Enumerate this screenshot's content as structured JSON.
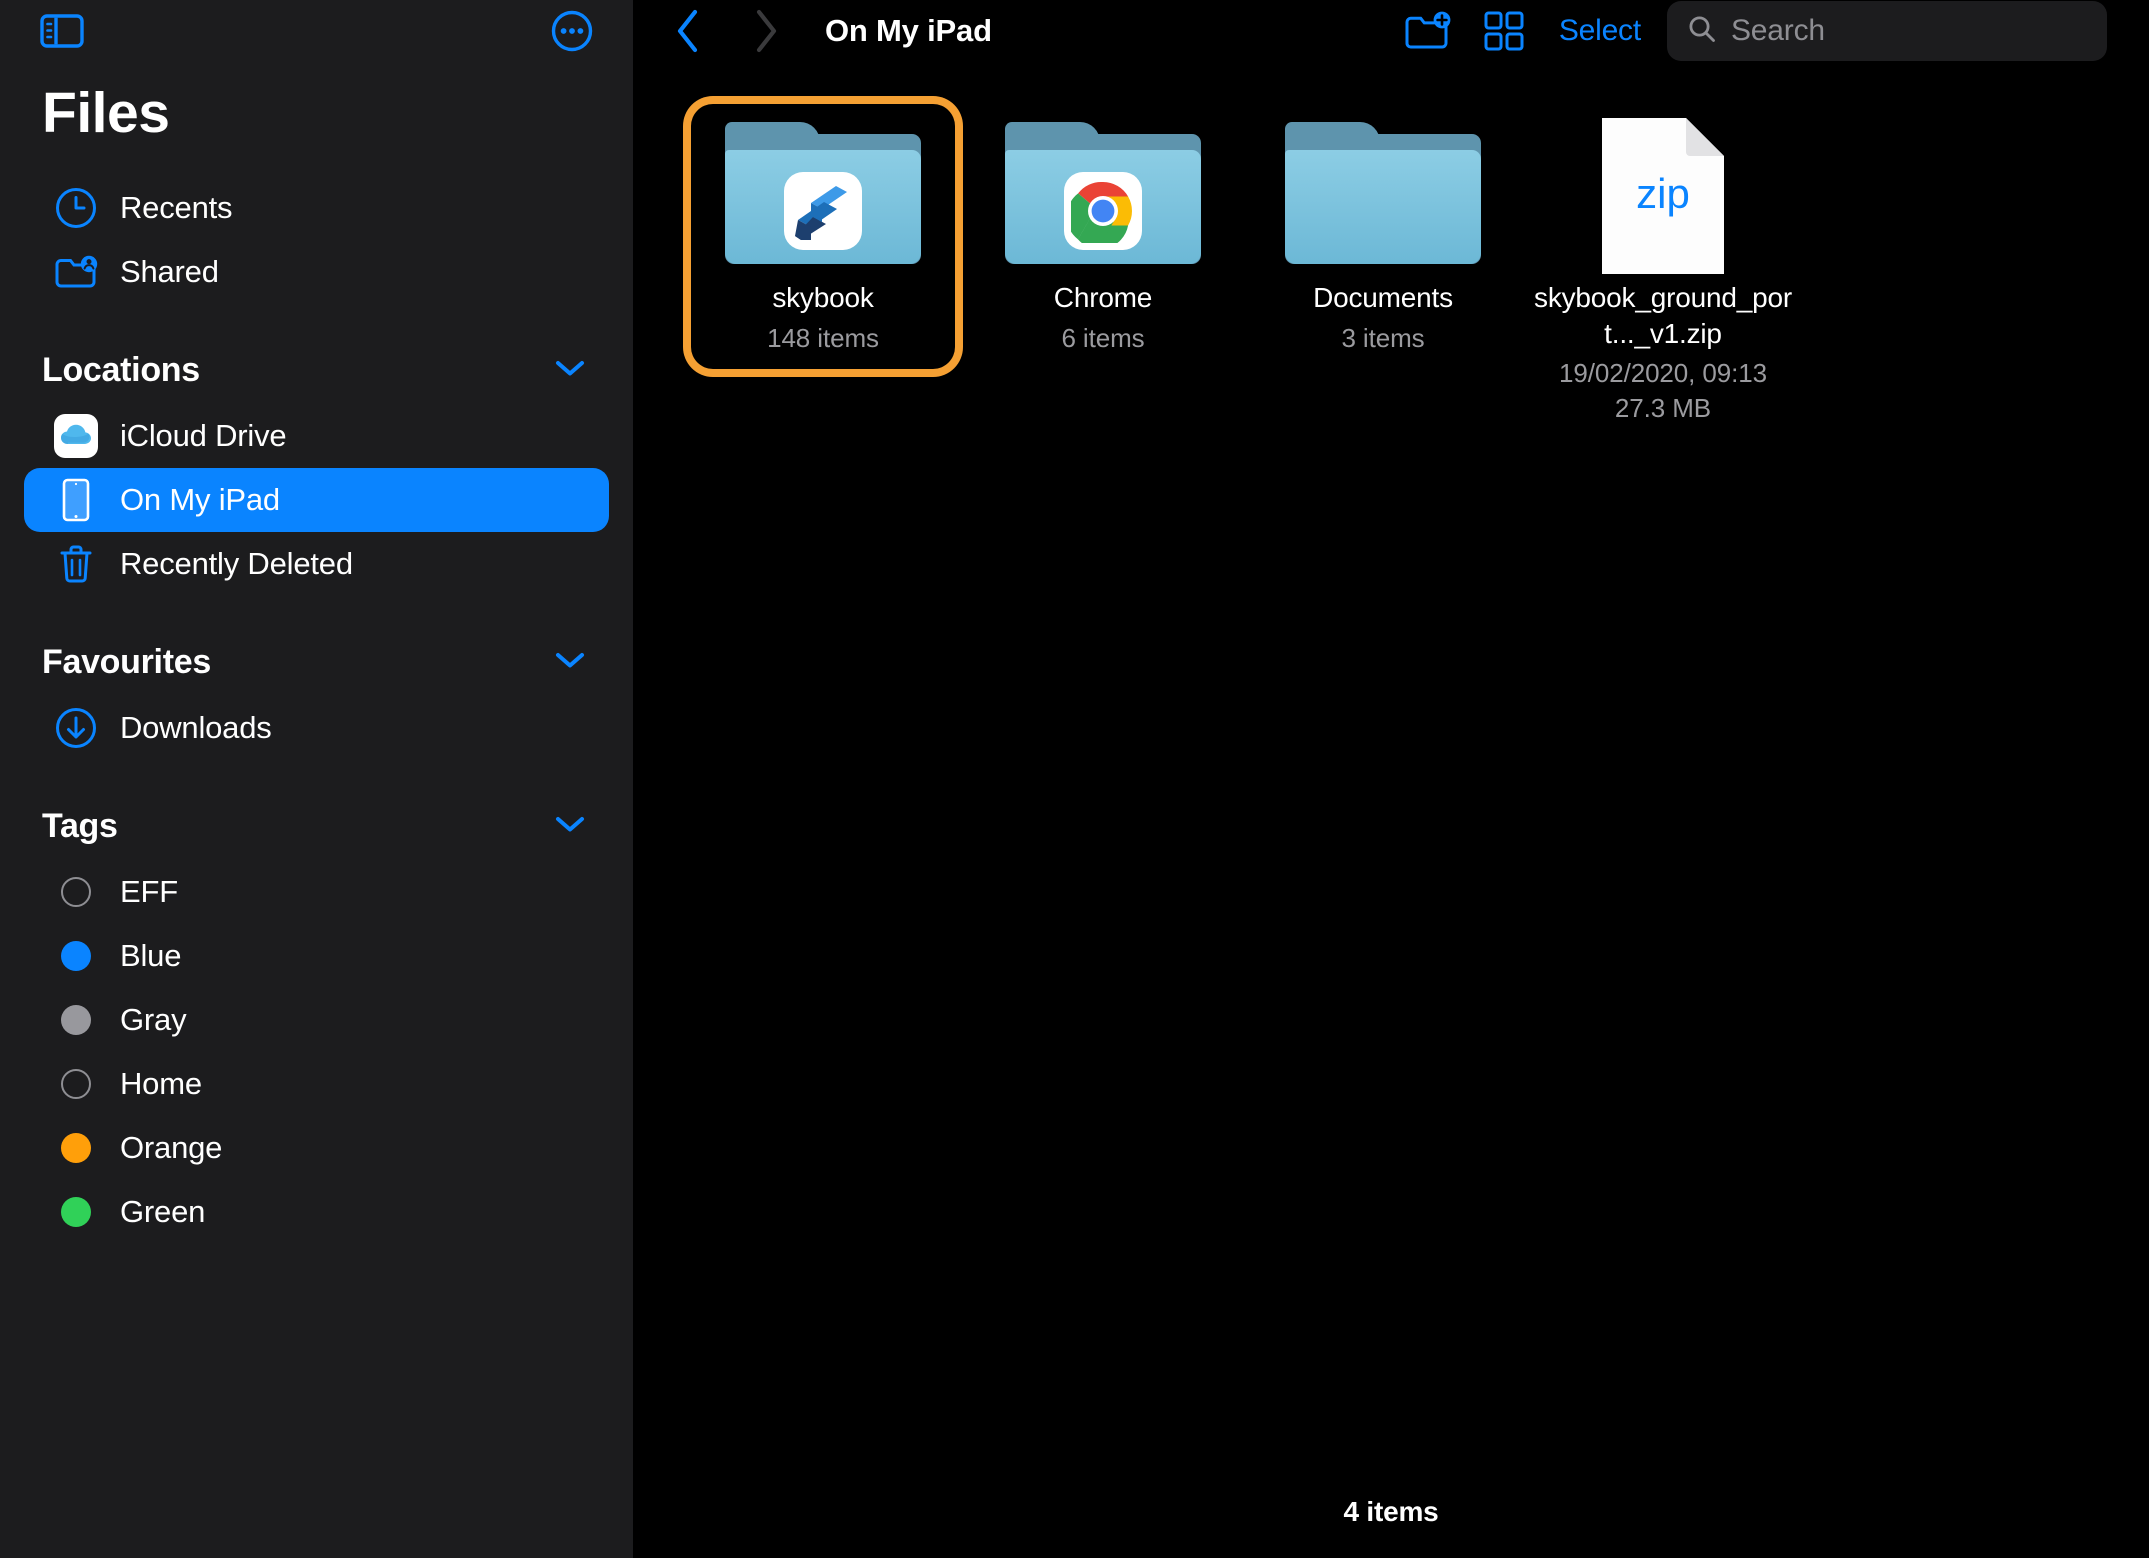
{
  "sidebar": {
    "toggle_icon": "sidebar-toggle-icon",
    "more_icon": "more-options-icon",
    "title": "Files",
    "nav": [
      {
        "label": "Recents",
        "icon": "clock-icon"
      },
      {
        "label": "Shared",
        "icon": "shared-folder-icon"
      }
    ],
    "sections": [
      {
        "title": "Locations",
        "chevron": "chevron-down-icon",
        "items": [
          {
            "label": "iCloud Drive",
            "icon": "icloud-drive-icon",
            "selected": false
          },
          {
            "label": "On My iPad",
            "icon": "ipad-icon",
            "selected": true
          },
          {
            "label": "Recently Deleted",
            "icon": "trash-icon",
            "selected": false
          }
        ]
      },
      {
        "title": "Favourites",
        "chevron": "chevron-down-icon",
        "items": [
          {
            "label": "Downloads",
            "icon": "download-circle-icon",
            "selected": false
          }
        ]
      },
      {
        "title": "Tags",
        "chevron": "chevron-down-icon",
        "items": [
          {
            "label": "EFF",
            "color": "none"
          },
          {
            "label": "Blue",
            "color": "#0a84ff"
          },
          {
            "label": "Gray",
            "color": "#98989d"
          },
          {
            "label": "Home",
            "color": "none"
          },
          {
            "label": "Orange",
            "color": "#ff9f0a"
          },
          {
            "label": "Green",
            "color": "#30d158"
          }
        ]
      }
    ]
  },
  "toolbar": {
    "back_icon": "chevron-left-icon",
    "forward_icon": "chevron-right-icon",
    "title": "On My iPad",
    "new_folder_icon": "new-folder-icon",
    "grid_view_icon": "grid-view-icon",
    "select_label": "Select",
    "search_icon": "search-icon",
    "search_placeholder": "Search",
    "search_value": ""
  },
  "files": [
    {
      "name": "skybook",
      "sub": "148 items",
      "type": "folder",
      "badge": "skybook-app-icon",
      "selected": true,
      "date": "",
      "size": ""
    },
    {
      "name": "Chrome",
      "sub": "6 items",
      "type": "folder",
      "badge": "chrome-app-icon",
      "selected": false,
      "date": "",
      "size": ""
    },
    {
      "name": "Documents",
      "sub": "3 items",
      "type": "folder",
      "badge": "",
      "selected": false,
      "date": "",
      "size": ""
    },
    {
      "name": "skybook_ground_port..._v1.zip",
      "sub": "",
      "type": "zip",
      "badge": "zip-file-icon",
      "zip_label": "zip",
      "selected": false,
      "date": "19/02/2020, 09:13",
      "size": "27.3 MB"
    }
  ],
  "status": {
    "item_count": "4 items"
  },
  "colors": {
    "accent": "#0a84ff",
    "selection_ring": "#f5a033",
    "sidebar_bg": "#1c1c1e",
    "main_bg": "#000000"
  }
}
